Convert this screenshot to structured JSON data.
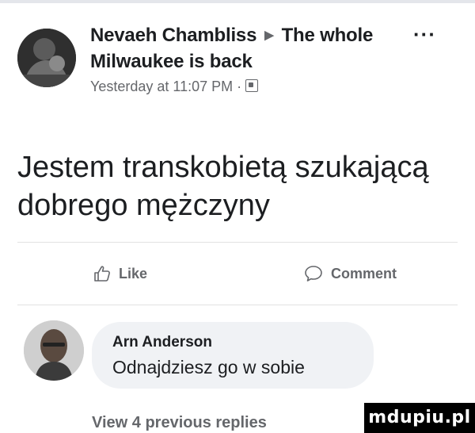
{
  "post": {
    "author": "Nevaeh Chambliss",
    "arrow_icon": "right-triangle-icon",
    "group": "The whole Milwaukee is back",
    "timestamp": "Yesterday at 11:07 PM",
    "separator": "·",
    "audience_icon": "group-audience-icon",
    "more_label": "···",
    "text": "Jestem transkobietą szukającą dobrego mężczyny"
  },
  "actions": {
    "like_label": "Like",
    "comment_label": "Comment"
  },
  "comment": {
    "author": "Arn Anderson",
    "text": "Odnajdziesz go w sobie"
  },
  "replies": {
    "view_label": "View 4 previous replies"
  },
  "watermark": {
    "text": "mdupiu.pl"
  },
  "colors": {
    "text_primary": "#1c1e21",
    "text_secondary": "#65676b",
    "bubble_bg": "#f0f2f5",
    "divider": "#e2e2e2"
  }
}
